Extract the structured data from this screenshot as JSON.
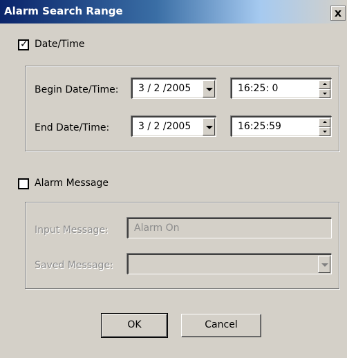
{
  "window": {
    "title": "Alarm Search Range",
    "close_label": "x"
  },
  "datetime_section": {
    "checkbox_label": "Date/Time",
    "checked": true,
    "begin": {
      "label": "Begin Date/Time:",
      "date": "3 / 2 /2005",
      "time": "16:25: 0"
    },
    "end": {
      "label": "End Date/Time:",
      "date": "3 / 2 /2005",
      "time": "16:25:59"
    }
  },
  "alarm_section": {
    "checkbox_label": "Alarm Message",
    "checked": false,
    "input_message_label": "Input Message:",
    "input_message_value": "Alarm On",
    "saved_message_label": "Saved Message:",
    "saved_message_value": ""
  },
  "buttons": {
    "ok": "OK",
    "cancel": "Cancel"
  }
}
